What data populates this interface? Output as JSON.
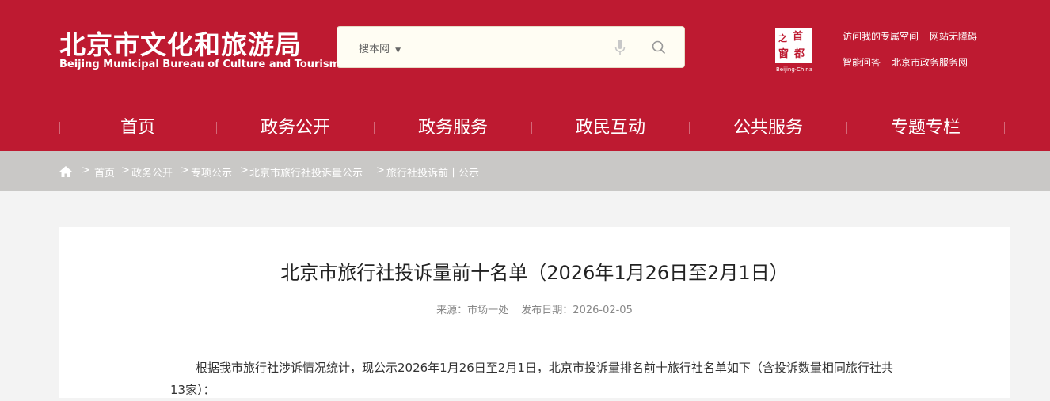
{
  "header": {
    "logo_cn": "北京市文化和旅游局",
    "logo_en": "Beijing Municipal Bureau of Culture and Tourism",
    "search": {
      "scope": "搜本网",
      "placeholder": ""
    },
    "emblem": {
      "chars": [
        "之",
        "首",
        "窗",
        "都"
      ],
      "en": "Beijing·China"
    },
    "links": {
      "special_space": "访问我的专属空间",
      "accessibility": "网站无障碍",
      "smart_qa": "智能问答",
      "gov_service": "北京市政务服务网"
    },
    "brand_color": "#be1a31"
  },
  "nav": {
    "items": [
      "首页",
      "政务公开",
      "政务服务",
      "政民互动",
      "公共服务",
      "专题专栏"
    ]
  },
  "breadcrumb": {
    "separator": ">",
    "items": [
      "首页",
      "政务公开",
      "专项公示",
      "北京市旅行社投诉量公示",
      "旅行社投诉前十公示"
    ]
  },
  "article": {
    "title": "北京市旅行社投诉量前十名单（2026年1月26日至2月1日）",
    "source": "来源：市场一处",
    "date": "发布日期：2026-02-05",
    "body": "根据我市旅行社涉诉情况统计，现公示2026年1月26日至2月1日，北京市投诉量排名前十旅行社名单如下（含投诉数量相同旅行社共13家）："
  }
}
